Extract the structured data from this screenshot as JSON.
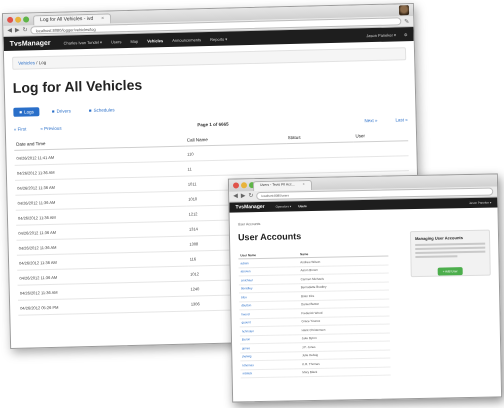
{
  "back_window": {
    "tab_title": "Log for All Vehicles - ivd",
    "tab_close": "×",
    "url": "localhost:8080/logger/vehicles/log",
    "app": {
      "brand": "TvsManager",
      "nav": [
        "Charles Ivan Tondel ▾",
        "Users",
        "Map",
        "Vehicles",
        "Announcements",
        "Reports ▾"
      ],
      "active_nav": "Vehicles",
      "user": "Jason Paneker ▾",
      "gear_glyph": "⚙"
    },
    "breadcrumb": [
      "Vehicles",
      "Log"
    ],
    "breadcrumb_sep": "/",
    "page_title": "Log for All Vehicles",
    "pills": [
      {
        "label": "Logs",
        "icon": "list-icon",
        "glyph": "■",
        "active": true
      },
      {
        "label": "Drivers",
        "icon": "list-icon",
        "glyph": "■",
        "active": false
      },
      {
        "label": "Schedules",
        "icon": "list-icon",
        "glyph": "■",
        "active": false
      }
    ],
    "pager": {
      "first": "« First",
      "previous": "« Previous",
      "info": "Page 1 of 6665",
      "next": "Next »",
      "last": "Last »"
    },
    "columns": [
      "Date and Time",
      "Call Name",
      "Status",
      "User"
    ],
    "rows": [
      [
        "04/26/2012 11:41 AM",
        "110",
        "",
        ""
      ],
      [
        "04/26/2012 11:36 AM",
        "11",
        "",
        ""
      ],
      [
        "04/26/2012 11:36 AM",
        "1011",
        "",
        ""
      ],
      [
        "04/26/2012 11:36 AM",
        "1010",
        "",
        ""
      ],
      [
        "04/26/2012 11:36 AM",
        "1212",
        "",
        ""
      ],
      [
        "04/26/2012 11:36 AM",
        "1314",
        "",
        ""
      ],
      [
        "04/26/2012 11:36 AM",
        "1308",
        "",
        ""
      ],
      [
        "04/26/2012 11:36 AM",
        "116",
        "",
        ""
      ],
      [
        "04/26/2012 11:36 AM",
        "1012",
        "",
        ""
      ],
      [
        "04/26/2012 11:36 AM",
        "1240",
        "",
        ""
      ],
      [
        "04/26/2012 05:26 PM",
        "1306",
        "",
        ""
      ]
    ]
  },
  "front_window": {
    "tab_title": "Users - Tevis Pil Acc...",
    "tab_close": "×",
    "url": "localhost:8080/users",
    "app": {
      "brand": "TvsManager",
      "nav": [
        "Operators ▾",
        "Users"
      ],
      "active_nav": "Users",
      "user": "Jason Paneker ▾"
    },
    "breadcrumb": "User Accounts",
    "page_title": "User Accounts",
    "columns": [
      "User Name",
      "Name"
    ],
    "rows": [
      [
        "admin",
        "Andrew Wilson"
      ],
      [
        "abrown",
        "Aaron Brown"
      ],
      [
        "cmichael",
        "Carmen Michaels"
      ],
      [
        "bbradley",
        "Bernadette Bradley"
      ],
      [
        "bfox",
        "Brian Fiks"
      ],
      [
        "dbutton",
        "Daniel Button"
      ],
      [
        "fwood",
        "Frederick Wood"
      ],
      [
        "gyount",
        "Grace Younce"
      ],
      [
        "hchristen",
        "Hank Christensen"
      ],
      [
        "jbyron",
        "Jake Byron"
      ],
      [
        "jjones",
        "J.P. Jones"
      ],
      [
        "jhelwig",
        "Julie Helwig"
      ],
      [
        "kthomas",
        "K.R. Thomas"
      ],
      [
        "mblack",
        "Mary Black"
      ]
    ],
    "panel": {
      "title": "Managing User Accounts",
      "button": "+ Add User"
    }
  },
  "colors": {
    "nav_bg": "#1e1e1e",
    "link": "#2a6fc9",
    "active_pill": "#2a6fc9",
    "status_green": "#4cae4c",
    "add_button": "#4cae4c"
  }
}
